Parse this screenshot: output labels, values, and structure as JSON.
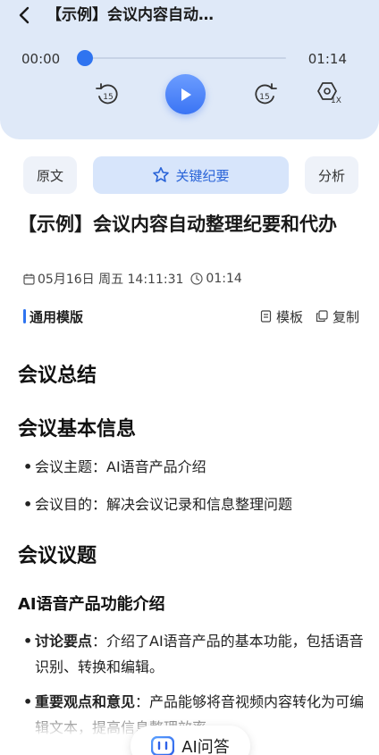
{
  "header": {
    "title": "【示例】会议内容自动…",
    "current_time": "00:00",
    "total_time": "01:14",
    "progress": 0,
    "rewind_seconds": "15",
    "forward_seconds": "15",
    "speed_label": "1X"
  },
  "tabs": {
    "original": "原文",
    "summary": "关键纪要",
    "analysis": "分析"
  },
  "doc": {
    "title": "【示例】会议内容自动整理纪要和代办",
    "date": "05月16日 周五  14:11:31",
    "duration": "01:14",
    "template_name": "通用模版",
    "template_action": "模板",
    "copy_action": "复制"
  },
  "content": {
    "h_summary": "会议总结",
    "h_basic": "会议基本信息",
    "basic_items": [
      "会议主题：AI语音产品介绍",
      "会议目的：解决会议记录和信息整理问题"
    ],
    "h_topics": "会议议题",
    "h_feature": "AI语音产品功能介绍",
    "feature_items": [
      {
        "label": "讨论要点",
        "text": "：介绍了AI语音产品的基本功能，包括语音识别、转换和编辑。"
      },
      {
        "label": "重要观点和意见",
        "text": "：产品能够将音视频内容转化为可编辑文本，提高信息整理效率。"
      }
    ]
  },
  "ai_button": {
    "label": "AI问答"
  },
  "colors": {
    "accent": "#2f74f0",
    "header_bg": "#dfe9f8",
    "active_tab_bg": "#d7e5fb"
  }
}
